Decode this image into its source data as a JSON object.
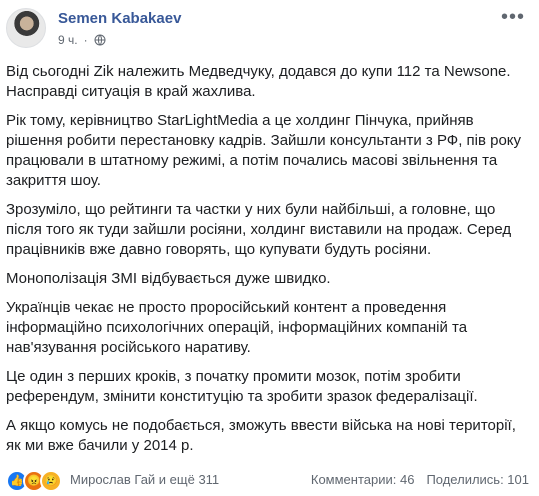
{
  "post": {
    "author": "Semen Kabakaev",
    "time": "9 ч.",
    "more_icon": "more-icon",
    "paragraphs": [
      "Від сьогодні Zik належить Медведчуку, додався до купи 112 та Newsone. Насправді ситуація в край жахлива.",
      "Рік тому, керівництво StarLightMedia а це холдинг Пінчука, прийняв рішення робити перестановку кадрів. Зайшли консультанти з РФ, пів року працювали в штатному режимі, а потім почались масові звільнення та закриття шоу.",
      "Зрозуміло, що рейтинги та частки у них були найбільші, а головне, що після того як туди зайшли росіяни, холдинг виставили на продаж. Серед працівників вже давно говорять, що купувати будуть росіяни.",
      "Монополізація ЗМІ відбувається дуже швидко.",
      "Українців чекає не просто проросійський контент а проведення інформаційно психологічних операцій, інформаційних компаній та нав'язування російського наративу.",
      "Це один з перших кроків, з початку промити мозок, потім зробити референдум, змінити конституцію та зробити зразок федералізації.",
      "А якщо комусь не подобається, зможуть ввести війська на нові території, як ми вже бачили у 2014 р."
    ]
  },
  "footer": {
    "reactions_text": "Мирослав Гай и ещё 311",
    "comments": "Комментарии: 46",
    "shares": "Поделились: 101"
  }
}
